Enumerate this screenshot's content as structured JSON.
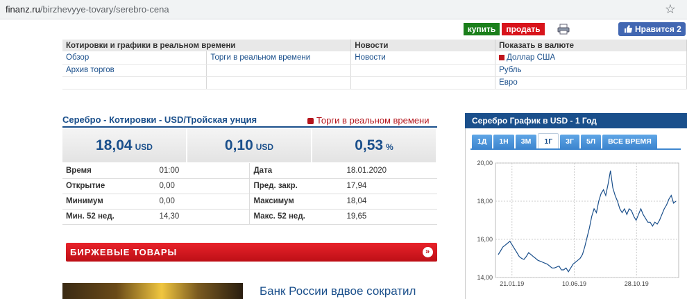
{
  "browser": {
    "url_domain": "finanz.ru",
    "url_path": "/birzhevyye-tovary/serebro-cena"
  },
  "actions": {
    "buy": "купить",
    "sell": "продать",
    "like": "Нравится 2"
  },
  "nav": {
    "headers": [
      "Котировки и графики в реальном времени",
      "Новости",
      "Показать в валюте"
    ],
    "rows": [
      [
        "Обзор",
        "Торги в реальном времени",
        "Новости",
        "Доллар США"
      ],
      [
        "Архив торгов",
        "",
        "",
        "Рубль"
      ],
      [
        "",
        "",
        "",
        "Евро"
      ]
    ]
  },
  "quote": {
    "title": "Серебро - Котировки - USD/Тройская унция",
    "realtime_link": "Торги в реальном времени",
    "values": [
      {
        "num": "18,04",
        "unit": "USD"
      },
      {
        "num": "0,10",
        "unit": "USD"
      },
      {
        "num": "0,53",
        "unit": "%"
      }
    ],
    "info": [
      [
        "Время",
        "01:00",
        "Дата",
        "18.01.2020"
      ],
      [
        "Открытие",
        "0,00",
        "Пред. закр.",
        "17,94"
      ],
      [
        "Минимум",
        "0,00",
        "Максимум",
        "18,04"
      ],
      [
        "Мин. 52 нед.",
        "14,30",
        "Макс. 52 нед.",
        "19,65"
      ]
    ]
  },
  "commodities_bar": "БИРЖЕВЫЕ ТОВАРЫ",
  "news_headline": "Банк России вдвое сократил",
  "chart_panel": {
    "title": "Серебро График в USD - 1 Год",
    "tabs": [
      "1Д",
      "1Н",
      "3М",
      "1Г",
      "3Г",
      "5Л",
      "ВСЕ ВРЕМЯ"
    ],
    "active_tab": "1Г"
  },
  "chart_data": {
    "type": "line",
    "title": "",
    "xlabel": "",
    "ylabel": "",
    "ylim": [
      14,
      20
    ],
    "yticks": [
      "14,00",
      "16,00",
      "18,00",
      "20,00"
    ],
    "xticks": [
      "21.01.19",
      "10.06.19",
      "28.10.19"
    ],
    "color": "#1a4f8b",
    "grid": true,
    "series": [
      {
        "values": [
          15.2,
          15.4,
          15.6,
          15.7,
          15.8,
          15.9,
          15.7,
          15.5,
          15.3,
          15.1,
          15.0,
          14.95,
          15.1,
          15.3,
          15.2,
          15.1,
          15.0,
          14.9,
          14.85,
          14.8,
          14.75,
          14.7,
          14.6,
          14.5,
          14.5,
          14.55,
          14.6,
          14.4,
          14.4,
          14.5,
          14.3,
          14.5,
          14.7,
          14.8,
          14.9,
          15.0,
          15.2,
          15.6,
          16.1,
          16.6,
          17.2,
          17.6,
          17.4,
          18.0,
          18.4,
          18.6,
          18.3,
          18.9,
          19.6,
          18.7,
          18.3,
          18.0,
          17.6,
          17.4,
          17.6,
          17.3,
          17.6,
          17.5,
          17.2,
          17.0,
          17.3,
          17.6,
          17.3,
          17.1,
          16.9,
          16.9,
          16.7,
          16.9,
          16.8,
          17.0,
          17.3,
          17.6,
          17.8,
          18.1,
          18.3,
          17.9,
          18.0
        ]
      }
    ]
  },
  "colors": {
    "brand": "#1a4f8b",
    "buy": "#1b7f1b",
    "sell": "#d8141b",
    "like": "#4267b2"
  }
}
